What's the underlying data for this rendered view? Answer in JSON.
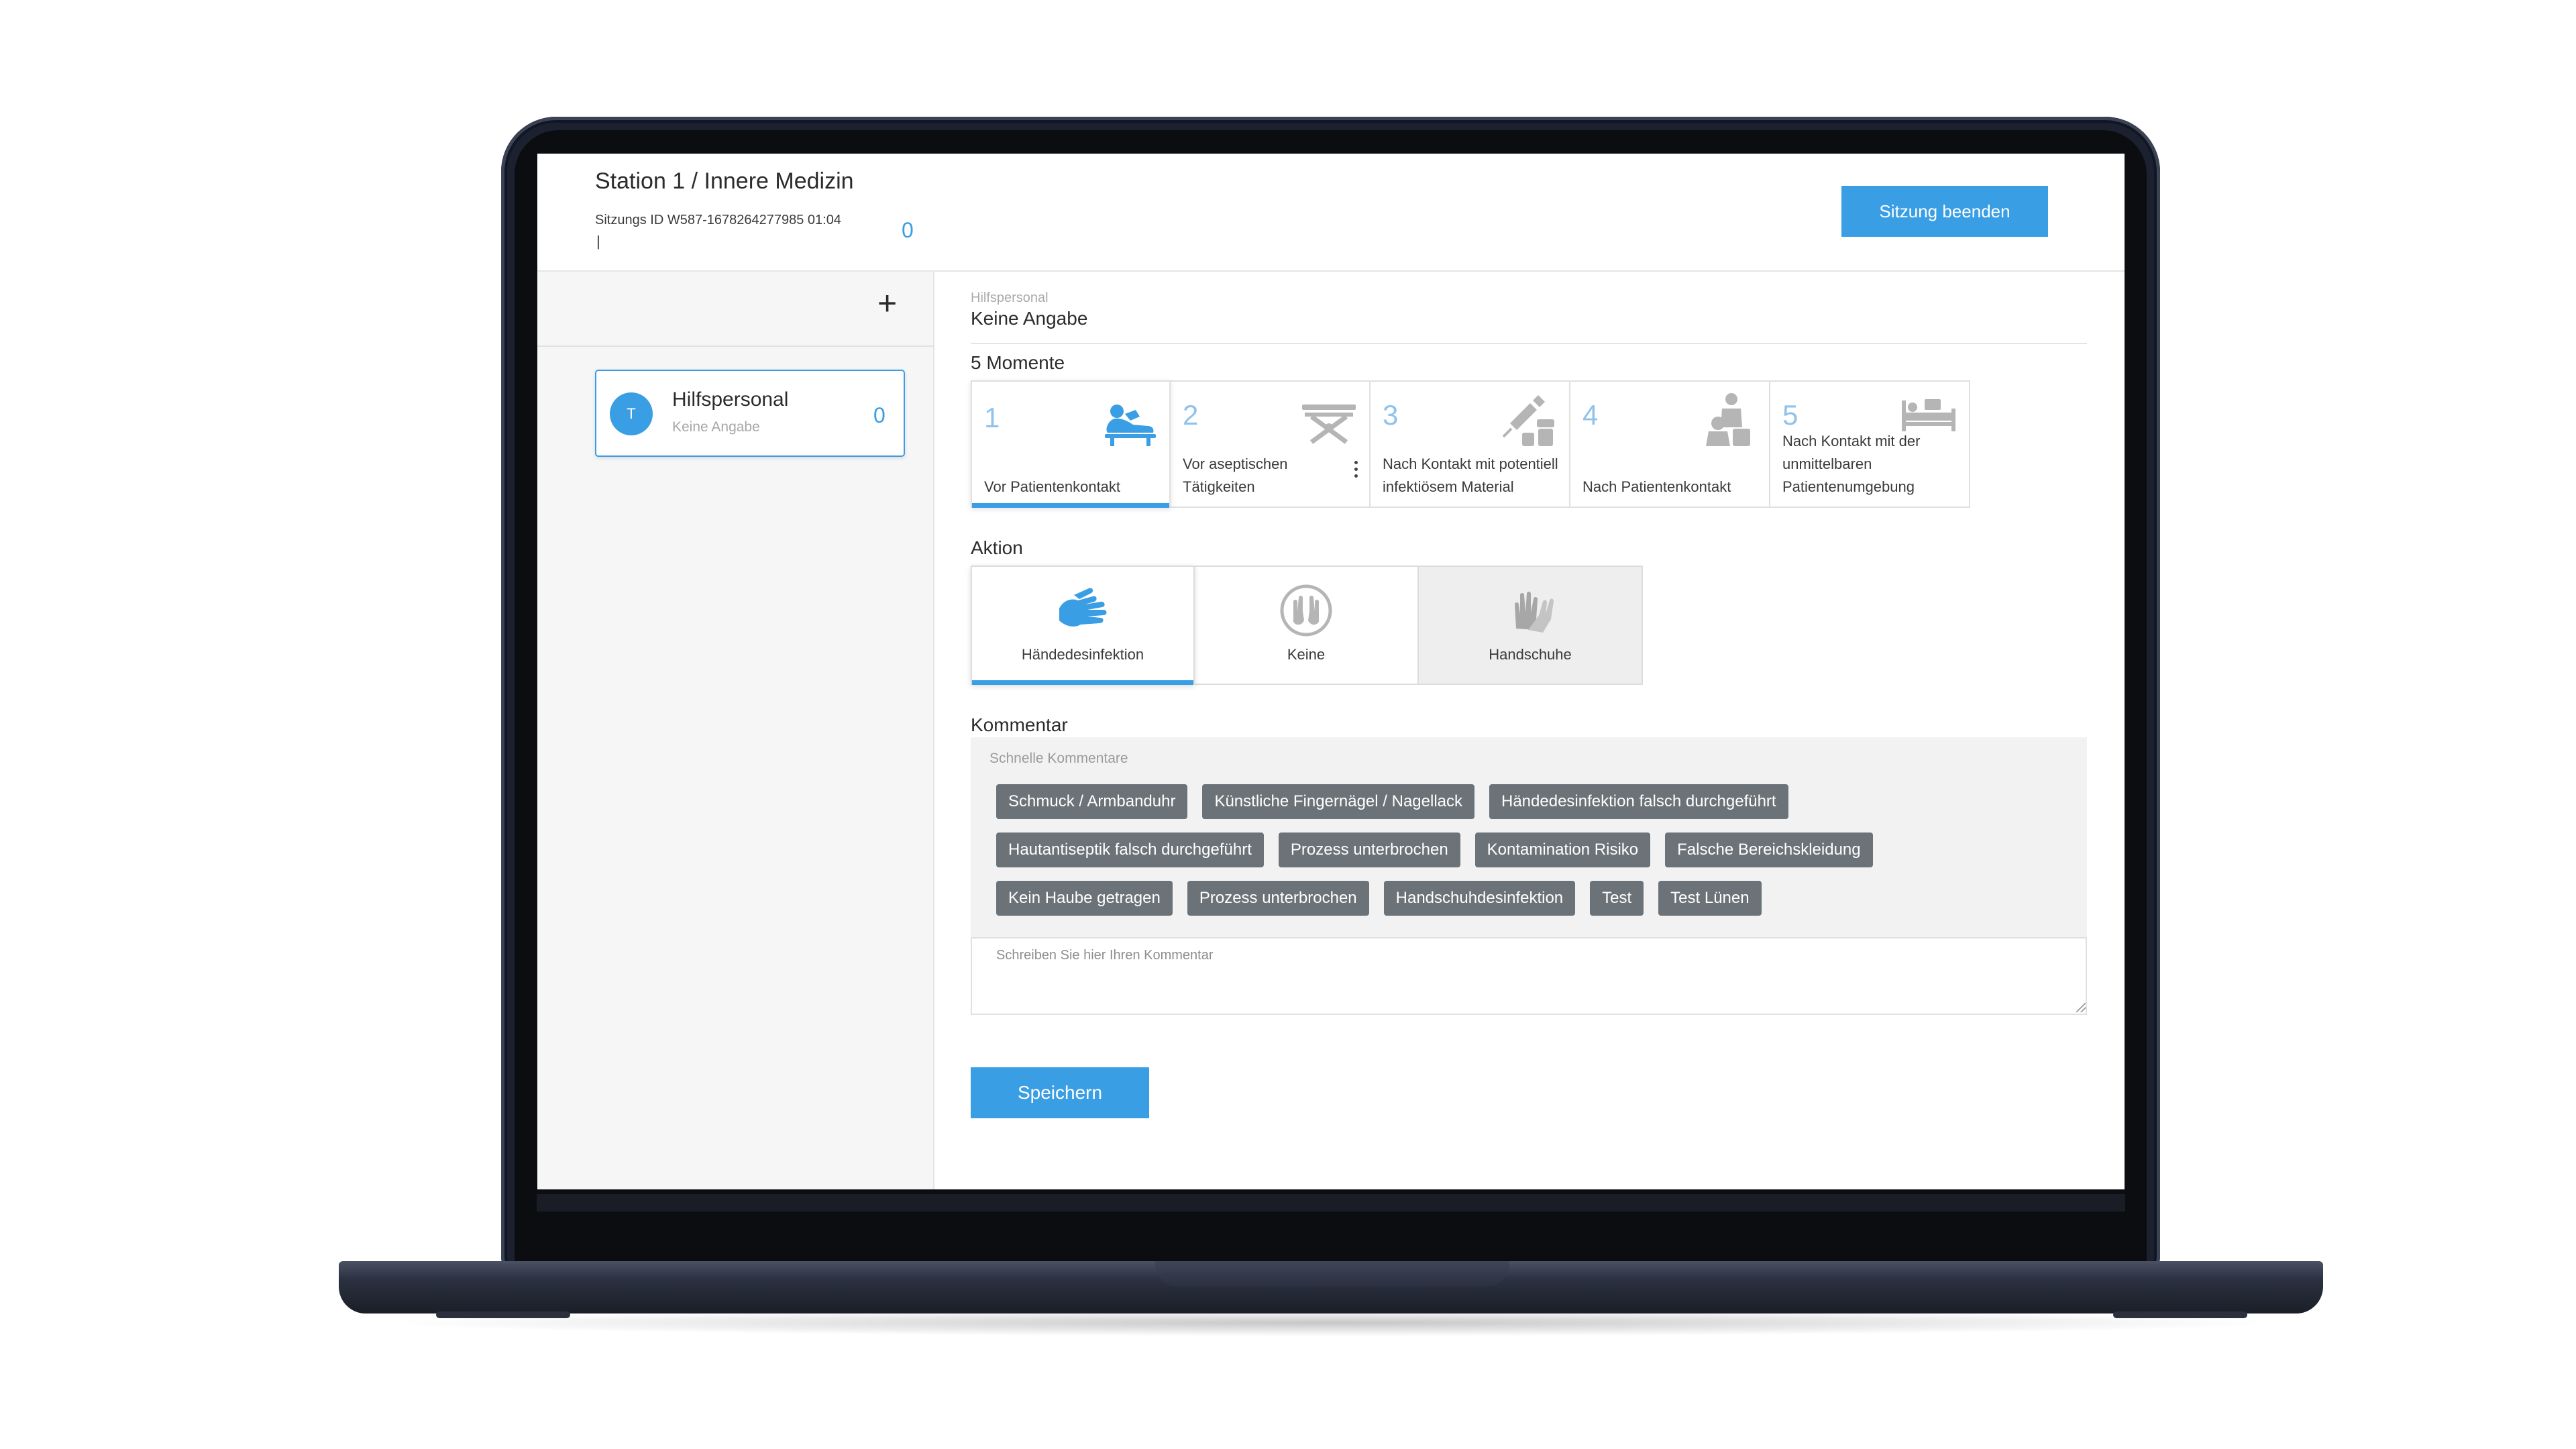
{
  "header": {
    "title": "Station 1 / Innere Medizin",
    "session_meta": "Sitzungs ID W587-1678264277985  01:04",
    "session_cursor": "|",
    "session_count": "0",
    "end_button": "Sitzung beenden"
  },
  "sidebar": {
    "add_icon": "plus-icon",
    "person": {
      "initial": "T",
      "name": "Hilfspersonal",
      "subtitle": "Keine Angabe",
      "count": "0"
    }
  },
  "main": {
    "selected_label": "Hilfspersonal",
    "selected_value": "Keine Angabe",
    "moments_title": "5 Momente",
    "moments": [
      {
        "num": "1",
        "label": "Vor Patientenkontakt",
        "icon": "patient-bed-icon",
        "active": true
      },
      {
        "num": "2",
        "label": "Vor aseptischen Tätigkeiten",
        "icon": "aseptic-table-icon",
        "active": false
      },
      {
        "num": "3",
        "label": "Nach Kontakt mit potentiell infektiösem Material",
        "icon": "syringe-icon",
        "active": false
      },
      {
        "num": "4",
        "label": "Nach Patientenkontakt",
        "icon": "patient-contact-icon",
        "active": false
      },
      {
        "num": "5",
        "label": "Nach Kontakt mit der unmittelbaren Patientenumgebung",
        "icon": "hospital-bed-icon",
        "active": false
      }
    ],
    "action_title": "Aktion",
    "actions": [
      {
        "label": "Händedesinfektion",
        "icon": "hand-disinfection-icon",
        "active": true
      },
      {
        "label": "Keine",
        "icon": "no-action-hands-icon",
        "active": false
      },
      {
        "label": "Handschuhe",
        "icon": "gloves-icon",
        "active": false
      }
    ],
    "comment_title": "Kommentar",
    "quick_comments_title": "Schnelle Kommentare",
    "quick_comments": [
      [
        "Schmuck / Armbanduhr",
        "Künstliche Fingernägel / Nagellack",
        "Händedesinfektion falsch durchgeführt"
      ],
      [
        "Hautantiseptik falsch durchgeführt",
        "Prozess unterbrochen",
        "Kontamination Risiko",
        "Falsche Bereichskleidung"
      ],
      [
        "Kein Haube getragen",
        "Prozess unterbrochen",
        "Handschuhdesinfektion",
        "Test",
        "Test Lünen"
      ]
    ],
    "comment_placeholder": "Schreiben Sie hier Ihren Kommentar",
    "save_button": "Speichern"
  },
  "colors": {
    "accent": "#3a9ee5",
    "chip": "#6c7378",
    "moment_number": "#8fc3ec"
  }
}
